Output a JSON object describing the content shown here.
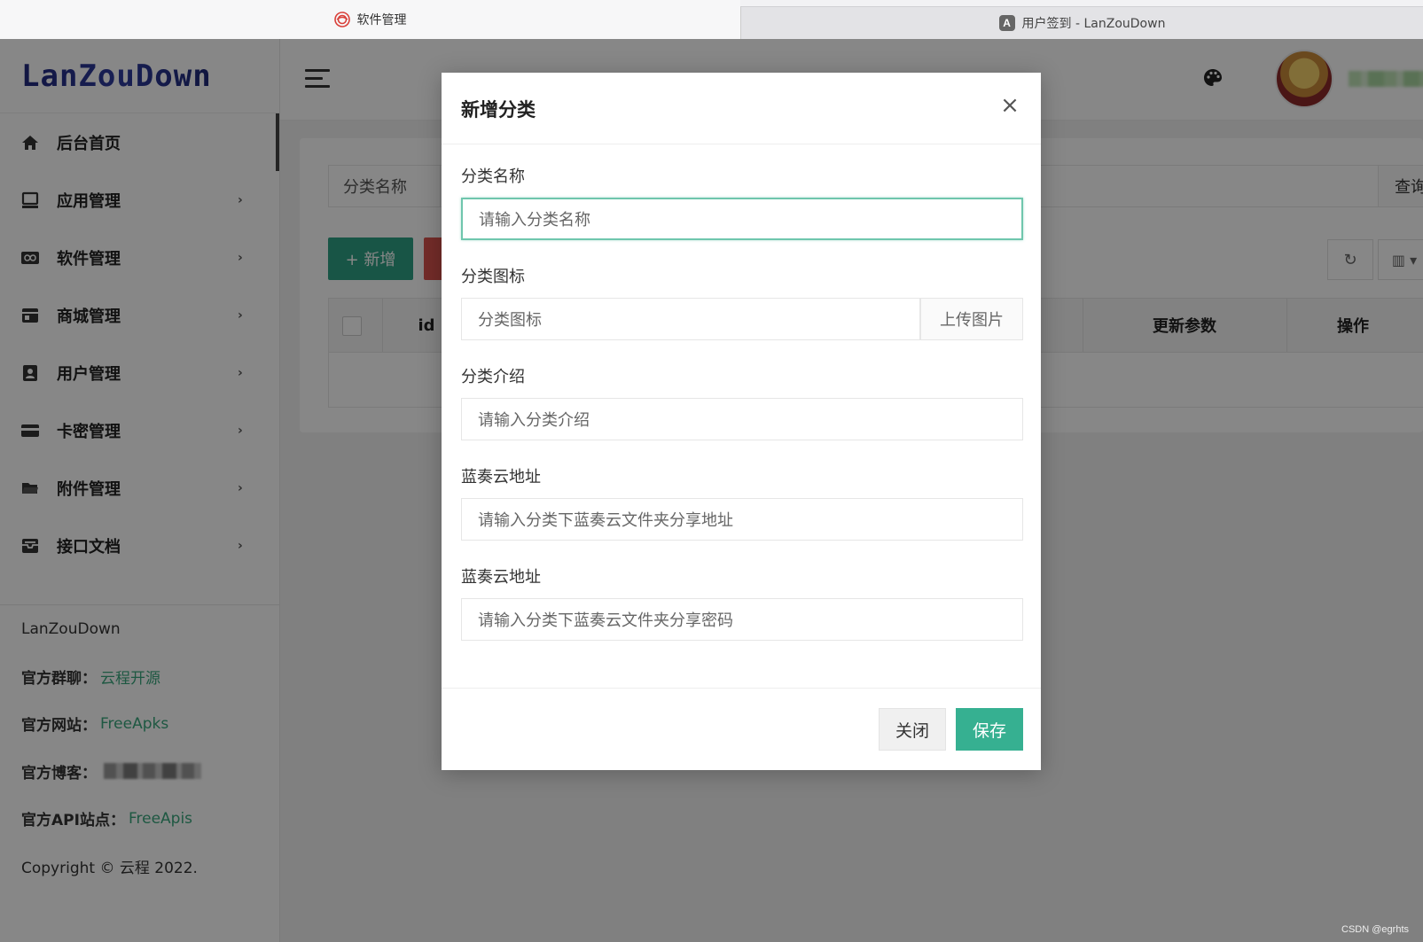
{
  "browser": {
    "tabs": [
      {
        "label": "软件管理",
        "icon": "target-logo-icon",
        "active": true
      },
      {
        "label": "用户签到 - LanZouDown",
        "icon": "letter-a-icon",
        "active": false
      }
    ],
    "tab_icon_letter": "A"
  },
  "sidebar": {
    "logo": "LanZouDown",
    "items": [
      {
        "label": "后台首页",
        "icon": "home-icon"
      },
      {
        "label": "应用管理",
        "icon": "monitor-icon"
      },
      {
        "label": "软件管理",
        "icon": "infinity-icon"
      },
      {
        "label": "商城管理",
        "icon": "store-icon"
      },
      {
        "label": "用户管理",
        "icon": "user-badge-icon"
      },
      {
        "label": "卡密管理",
        "icon": "card-icon"
      },
      {
        "label": "附件管理",
        "icon": "folder-icon"
      },
      {
        "label": "接口文档",
        "icon": "inbox-icon"
      }
    ],
    "arrow": "›",
    "footer": {
      "brand": "LanZouDown",
      "group_label": "官方群聊：",
      "group_link": "云程开源",
      "site_label": "官方网站：",
      "site_link": "FreeApks",
      "blog_label": "官方博客：",
      "api_label": "官方API站点：",
      "api_link": "FreeApis",
      "copyright": "Copyright © 云程 2022."
    }
  },
  "content": {
    "search_label": "分类名称",
    "search_button": "查询",
    "add_button": "+ 新增",
    "refresh_glyph": "↻",
    "columns_glyph": "▥ ▾",
    "table_headers": [
      "id",
      "更新参数",
      "操作"
    ]
  },
  "modal": {
    "title": "新增分类",
    "close_glyph": "×",
    "fields": [
      {
        "label": "分类名称",
        "placeholder": "请输入分类名称"
      },
      {
        "label": "分类图标",
        "placeholder": "分类图标",
        "button": "上传图片"
      },
      {
        "label": "分类介绍",
        "placeholder": "请输入分类介绍"
      },
      {
        "label": "蓝奏云地址",
        "placeholder": "请输入分类下蓝奏云文件夹分享地址"
      },
      {
        "label": "蓝奏云地址",
        "placeholder": "请输入分类下蓝奏云文件夹分享密码"
      }
    ],
    "close_button": "关闭",
    "save_button": "保存"
  },
  "watermark": "CSDN @egrhts",
  "colors": {
    "accent": "#36b091",
    "danger": "#d9534f",
    "link": "#3aa77e",
    "logo": "#222a7d"
  }
}
